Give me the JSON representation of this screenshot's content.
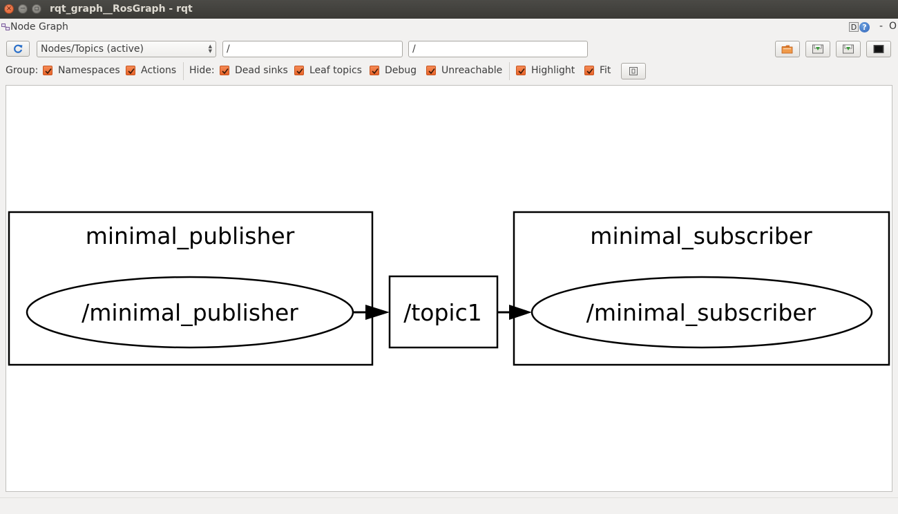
{
  "window": {
    "title": "rqt_graph__RosGraph - rqt"
  },
  "dock": {
    "title": "Node Graph",
    "d_button": "D",
    "help_button": "?",
    "minimize": "-",
    "close": "O"
  },
  "toolbar": {
    "graph_type": "Nodes/Topics (active)",
    "filter_include": "/",
    "filter_exclude": "/",
    "buttons": [
      "load-dot-icon",
      "save-dot-icon",
      "save-svg-icon",
      "save-image-icon"
    ]
  },
  "options": {
    "group_label": "Group:",
    "group": [
      {
        "label": "Namespaces",
        "checked": true
      },
      {
        "label": "Actions",
        "checked": true
      }
    ],
    "hide_label": "Hide:",
    "hide": [
      {
        "label": "Dead sinks",
        "checked": true
      },
      {
        "label": "Leaf topics",
        "checked": true
      },
      {
        "label": "Debug",
        "checked": true
      },
      {
        "label": "Unreachable",
        "checked": true
      }
    ],
    "view": [
      {
        "label": "Highlight",
        "checked": true
      },
      {
        "label": "Fit",
        "checked": true
      }
    ]
  },
  "graph": {
    "clusters": [
      {
        "label": "minimal_publisher"
      },
      {
        "label": "minimal_subscriber"
      }
    ],
    "nodes": [
      {
        "label": "/minimal_publisher",
        "kind": "node"
      },
      {
        "label": "/topic1",
        "kind": "topic"
      },
      {
        "label": "/minimal_subscriber",
        "kind": "node"
      }
    ],
    "edges": [
      {
        "from": "/minimal_publisher",
        "to": "/topic1"
      },
      {
        "from": "/topic1",
        "to": "/minimal_subscriber"
      }
    ]
  },
  "colors": {
    "accent_checkbox": "#e8642a",
    "titlebar": "#3b3a36",
    "canvas": "#ffffff"
  }
}
